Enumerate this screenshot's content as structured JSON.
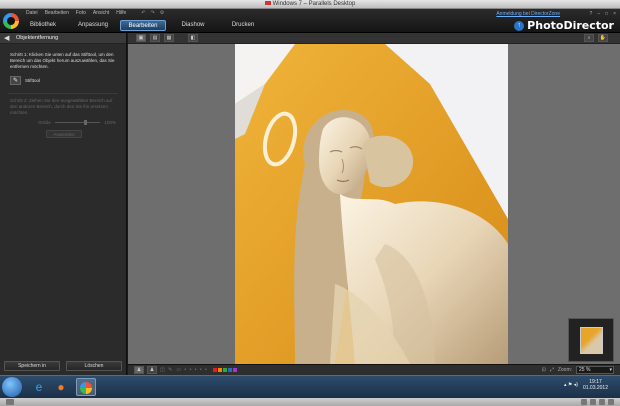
{
  "window": {
    "title": "Windows 7 – Parallels Desktop"
  },
  "menu": [
    "Datei",
    "Bearbeiten",
    "Foto",
    "Ansicht",
    "Hilfe"
  ],
  "menu_tools": [
    "↶",
    "↷",
    "⚙"
  ],
  "tabs": [
    {
      "label": "Bibliothek"
    },
    {
      "label": "Anpassung"
    },
    {
      "label": "Bearbeiten"
    },
    {
      "label": "Diashow"
    },
    {
      "label": "Drucken"
    }
  ],
  "active_tab": "Bearbeiten",
  "help_link": "Anmeldung bei DirectorZone",
  "window_controls": [
    "?",
    "–",
    "□",
    "×"
  ],
  "brand": {
    "name": "PhotoDirector"
  },
  "panel": {
    "title": "Objektentfernung",
    "step1": "Schritt 1: Klicken Sie unten auf das Stifttool, um den Bereich um das Objekt herum auszuwählen, das Sie entfernen möchten.",
    "brush_label": "Stifttool",
    "step2": "Schritt 2: Ziehen Sie den ausgewählten Bereich auf den anderen Bereich, durch den Sie ihn ersetzen möchten.",
    "size_label": "Größe",
    "size_value": "100%",
    "apply_label": "Anwenden",
    "save_label": "Speichern in",
    "delete_label": "Löschen"
  },
  "zoom": {
    "label": "Zoom:",
    "value": "25 %"
  },
  "clock": {
    "time": "19:17",
    "date": "01.03.2012"
  },
  "colors": {
    "accent": "#2a73c9",
    "wall": "#e9a52a",
    "canvas": "#6e6e6e"
  }
}
